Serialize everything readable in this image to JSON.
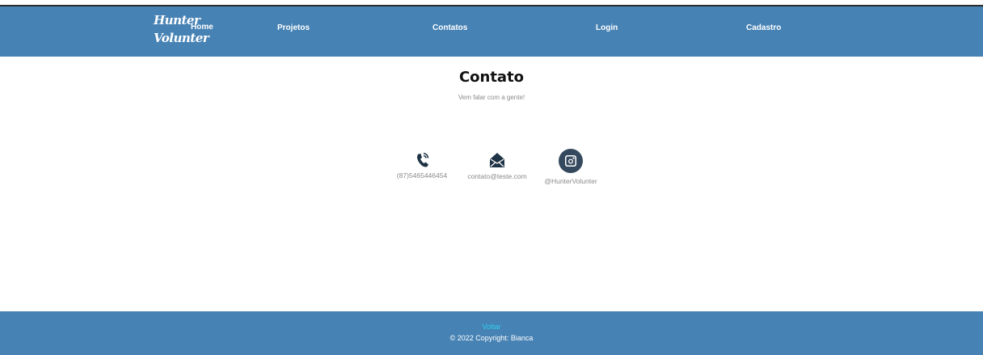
{
  "nav": {
    "brand_line1": "Hunter",
    "brand_line2": "Volunter",
    "items": [
      {
        "label": "Home"
      },
      {
        "label": "Projetos"
      },
      {
        "label": "Contatos"
      },
      {
        "label": "Login"
      },
      {
        "label": "Cadastro"
      }
    ]
  },
  "main": {
    "title": "Contato",
    "subtitle": "Vem falar com a gente!",
    "contacts": [
      {
        "icon": "phone-icon",
        "label": "(87)5465446454"
      },
      {
        "icon": "envelope-icon",
        "label": "contato@teste.com"
      },
      {
        "icon": "instagram-icon",
        "label": "@HunterVolunter"
      }
    ]
  },
  "footer": {
    "back_label": "Voltar",
    "copyright": "© 2022 Copyright: Bianca"
  },
  "colors": {
    "brand_blue": "#4682b4",
    "icon_dark": "#1f3346",
    "link_cyan": "#2fd0ef"
  }
}
